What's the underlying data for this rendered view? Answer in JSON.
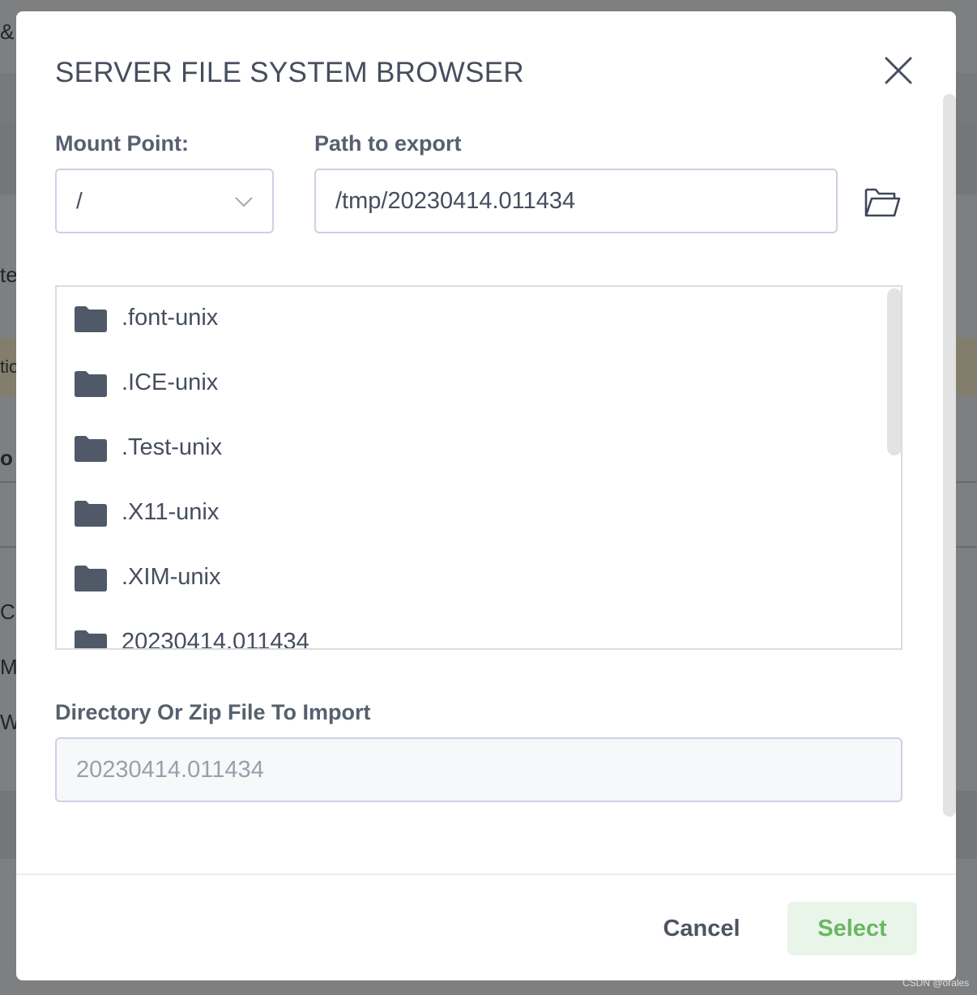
{
  "background": {
    "fragments": [
      "&",
      "te",
      "tio",
      "o",
      "Co",
      "M",
      "We"
    ]
  },
  "dialog": {
    "title": "SERVER FILE SYSTEM BROWSER",
    "mount_point": {
      "label": "Mount Point:",
      "value": "/"
    },
    "path": {
      "label": "Path to export",
      "value": "/tmp/20230414.011434"
    },
    "entries": [
      {
        "name": ".font-unix",
        "icon": "folder-icon"
      },
      {
        "name": ".ICE-unix",
        "icon": "folder-icon"
      },
      {
        "name": ".Test-unix",
        "icon": "folder-icon"
      },
      {
        "name": ".X11-unix",
        "icon": "folder-icon"
      },
      {
        "name": ".XIM-unix",
        "icon": "folder-icon"
      },
      {
        "name": "20230414.011434",
        "icon": "folder-icon"
      }
    ],
    "import": {
      "label": "Directory Or Zip File To Import",
      "value": "20230414.011434"
    },
    "buttons": {
      "cancel": "Cancel",
      "select": "Select"
    }
  },
  "colors": {
    "accent_green": "#6bb664",
    "select_bg": "#eaf5e9",
    "text": "#464e5e",
    "border": "#cfd0e2"
  },
  "watermark": "CSDN @orales"
}
